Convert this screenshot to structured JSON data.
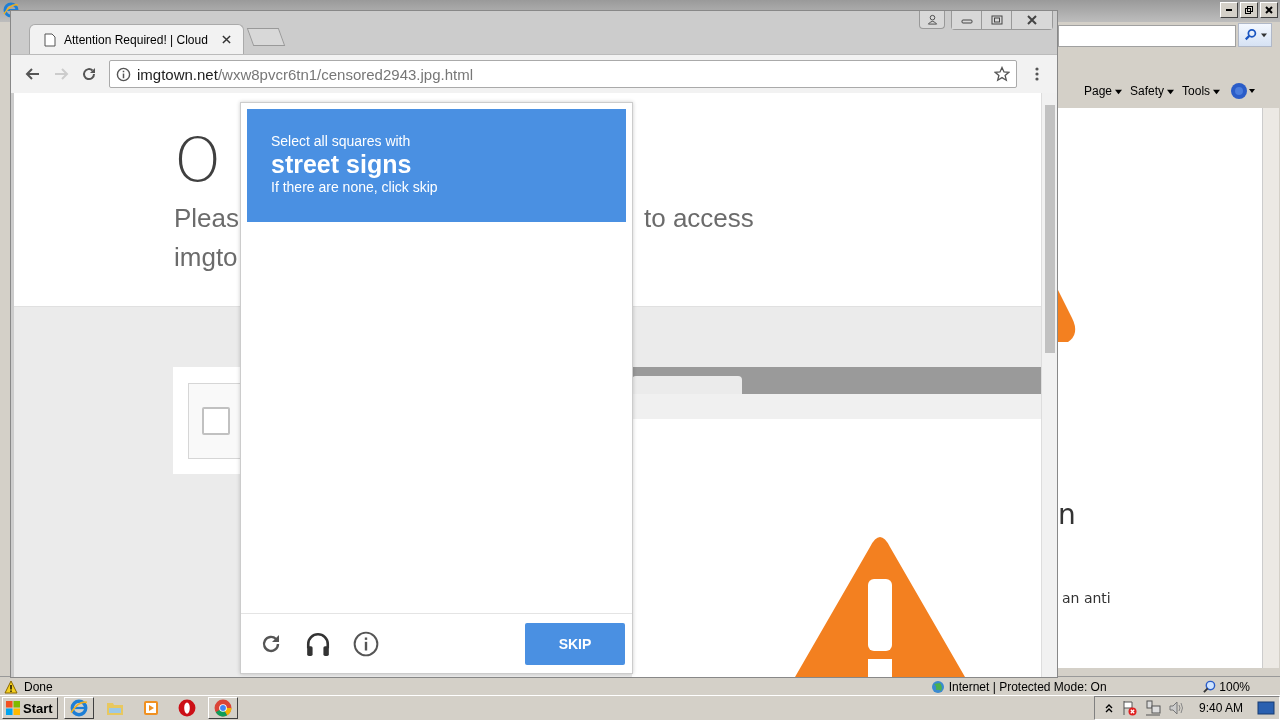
{
  "ie_window": {
    "command_bar": [
      {
        "label": "Page"
      },
      {
        "label": "Safety"
      },
      {
        "label": "Tools"
      }
    ],
    "page_fragments": [
      "n",
      "an anti"
    ],
    "status": {
      "text": "Done",
      "zone": "Internet | Protected Mode: On",
      "zoom": "100%"
    }
  },
  "browser": {
    "tabs": [
      {
        "title": "Attention Required! | Cloud",
        "selected": true
      }
    ],
    "address": {
      "domain": "imgtown.net",
      "path": "/wxw8pvcr6tn1/censored2943.jpg.html"
    },
    "page": {
      "heading": "O",
      "subtitle": [
        "Pleas",
        "to access",
        "imgto"
      ],
      "checkbox": {
        "checked": false
      }
    }
  },
  "captcha": {
    "prompt": "Select all squares with",
    "target": "street signs",
    "hint": "If there are none, click skip",
    "button": "SKIP"
  },
  "taskbar": {
    "start": "Start",
    "clock": "9:40 AM"
  }
}
